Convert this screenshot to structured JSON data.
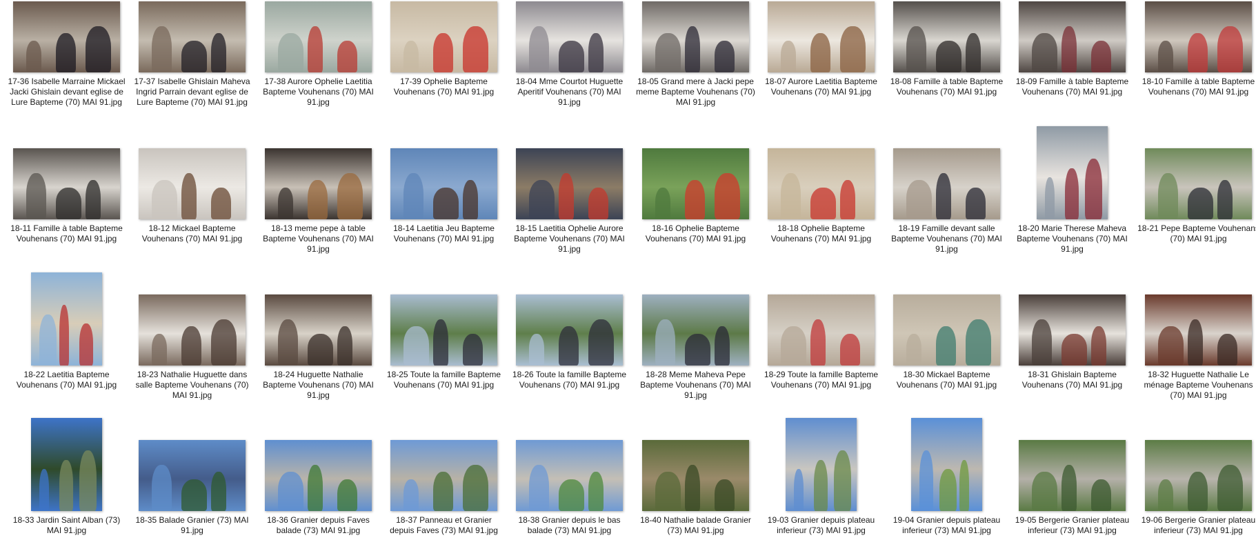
{
  "view": {
    "type": "file-explorer-large-icons",
    "items": [
      {
        "name": "17-36 Isabelle Marraine Mickael Jacki Ghislain devant eglise de Lure Bapteme (70) MAI 91.jpg",
        "orientation": "landscape",
        "palette": [
          "#6b5a4e",
          "#b9b0a4",
          "#1c1a22"
        ]
      },
      {
        "name": "17-37 Isabelle Ghislain Maheva Ingrid Parrain devant eglise de Lure Bapteme (70) MAI 91.jpg",
        "orientation": "landscape",
        "palette": [
          "#7a6a5c",
          "#c4bcb0",
          "#221f26"
        ]
      },
      {
        "name": "17-38 Aurore Ophelie Laetitia Bapteme Vouhenans (70) MAI 91.jpg",
        "orientation": "landscape",
        "palette": [
          "#9aa8a0",
          "#cfd3cc",
          "#b83a32"
        ]
      },
      {
        "name": "17-39 Ophelie Bapteme Vouhenans (70) MAI 91.jpg",
        "orientation": "landscape",
        "palette": [
          "#c7b9a3",
          "#dcd2c1",
          "#c8322a"
        ]
      },
      {
        "name": "18-04 Mme Courtot Huguette Aperitif Vouhenans (70) MAI 91.jpg",
        "orientation": "landscape",
        "palette": [
          "#8d8a90",
          "#e6e3df",
          "#3a3440"
        ]
      },
      {
        "name": "18-05 Grand mere à Jacki pepe meme Bapteme Vouhenans (70) MAI 91.jpg",
        "orientation": "landscape",
        "palette": [
          "#6f6a66",
          "#dcd8d2",
          "#2c2a35"
        ]
      },
      {
        "name": "18-07 Aurore Laetitia Bapteme Vouhenans (70) MAI 91.jpg",
        "orientation": "landscape",
        "palette": [
          "#b9a995",
          "#ece7df",
          "#8a6040"
        ]
      },
      {
        "name": "18-08 Famille à table Bapteme Vouhenans (70) MAI 91.jpg",
        "orientation": "landscape",
        "palette": [
          "#55504c",
          "#d9d6d0",
          "#2f2b2a"
        ]
      },
      {
        "name": "18-09 Famille à table Bapteme Vouhenans (70) MAI 91.jpg",
        "orientation": "landscape",
        "palette": [
          "#4f4743",
          "#cfcac4",
          "#7a2f35"
        ]
      },
      {
        "name": "18-10 Famille à table Bapteme Vouhenans (70) MAI 91.jpg",
        "orientation": "landscape",
        "palette": [
          "#5b4e46",
          "#cfc7bd",
          "#c0393a"
        ]
      },
      {
        "name": "18-11 Famille à table Bapteme Vouhenans (70) MAI 91.jpg",
        "orientation": "landscape",
        "palette": [
          "#5a5550",
          "#d8d4ce",
          "#2e2c2b"
        ]
      },
      {
        "name": "18-12 Mickael Bapteme Vouhenans (70) MAI 91.jpg",
        "orientation": "landscape",
        "palette": [
          "#c9c4be",
          "#ece9e4",
          "#6a4a34"
        ]
      },
      {
        "name": "18-13 meme pepe à table Bapteme Vouhenans (70) MAI 91.jpg",
        "orientation": "landscape",
        "palette": [
          "#3b3430",
          "#c8c0b6",
          "#9a6a3e"
        ]
      },
      {
        "name": "18-14 Laetitia Jeu Bapteme Vouhenans (70) MAI 91.jpg",
        "orientation": "landscape",
        "palette": [
          "#5f86b8",
          "#8ba9cf",
          "#4a3328"
        ]
      },
      {
        "name": "18-15 Laetitia Ophelie Aurore Bapteme Vouhenans (70) MAI 91.jpg",
        "orientation": "landscape",
        "palette": [
          "#3c4355",
          "#8c7c66",
          "#c43a2e"
        ]
      },
      {
        "name": "18-16 Ophelie Bapteme Vouhenans (70) MAI 91.jpg",
        "orientation": "landscape",
        "palette": [
          "#4f7a3e",
          "#7aa25a",
          "#cf3a2c"
        ]
      },
      {
        "name": "18-18 Ophelie Bapteme Vouhenans (70) MAI 91.jpg",
        "orientation": "landscape",
        "palette": [
          "#c5b59a",
          "#d9cfbd",
          "#c8342c"
        ]
      },
      {
        "name": "18-19 Famille devant salle Bapteme Vouhenans (70) MAI 91.jpg",
        "orientation": "landscape",
        "palette": [
          "#a59a8c",
          "#d7d2ca",
          "#2a2a34"
        ]
      },
      {
        "name": "18-20 Marie Therese Maheva Bapteme Vouhenans (70) MAI 91.jpg",
        "orientation": "portrait",
        "palette": [
          "#8f9aa5",
          "#e8e4df",
          "#8a2a36"
        ]
      },
      {
        "name": "18-21 Pepe Bapteme Vouhenans (70) MAI 91.jpg",
        "orientation": "landscape",
        "palette": [
          "#6f8a5a",
          "#c9c4bc",
          "#2b2c34"
        ]
      },
      {
        "name": "18-22 Laetitia Bapteme Vouhenans (70) MAI 91.jpg",
        "orientation": "portrait",
        "palette": [
          "#8db3d8",
          "#d8cdb8",
          "#b83030"
        ]
      },
      {
        "name": "18-23 Nathalie Huguette dans salle Bapteme Vouhenans (70) MAI 91.jpg",
        "orientation": "landscape",
        "palette": [
          "#7a6a5e",
          "#e5e1db",
          "#4a3a32"
        ]
      },
      {
        "name": "18-24 Huguette  Nathalie Bapteme Vouhenans (70) MAI 91.jpg",
        "orientation": "landscape",
        "palette": [
          "#5a4a40",
          "#d8d2c8",
          "#3a2f2a"
        ]
      },
      {
        "name": "18-25 Toute la famille Bapteme Vouhenans (70) MAI 91.jpg",
        "orientation": "landscape",
        "palette": [
          "#a9bcd0",
          "#5e7e4a",
          "#2c2c38"
        ]
      },
      {
        "name": "18-26 Toute la famille Bapteme Vouhenans (70) MAI 91.jpg",
        "orientation": "landscape",
        "palette": [
          "#aabed2",
          "#5f7f4b",
          "#2d2d39"
        ]
      },
      {
        "name": "18-28 Meme Maheva Pepe Bapteme Vouhenans (70) MAI 91.jpg",
        "orientation": "landscape",
        "palette": [
          "#9eb0c0",
          "#5d7a48",
          "#2a2a36"
        ]
      },
      {
        "name": "18-29 Toute la famille Bapteme Vouhenans (70) MAI 91.jpg",
        "orientation": "landscape",
        "palette": [
          "#b5a898",
          "#d6d0c6",
          "#c0383a"
        ]
      },
      {
        "name": "18-30 Mickael Bapteme Vouhenans (70) MAI 91.jpg",
        "orientation": "landscape",
        "palette": [
          "#b8ad9c",
          "#cfc6b6",
          "#3f7c6f"
        ]
      },
      {
        "name": "18-31 Ghislain Bapteme Vouhenans (70) MAI 91.jpg",
        "orientation": "landscape",
        "palette": [
          "#4a3f3a",
          "#e6e2dc",
          "#7a3a30"
        ]
      },
      {
        "name": "18-32 Huguette Nathalie Le ménage Bapteme Vouhenans (70) MAI 91.jpg",
        "orientation": "landscape",
        "palette": [
          "#6a3a2c",
          "#d9d3cc",
          "#3a2a24"
        ]
      },
      {
        "name": "18-33 Jardin Saint Alban (73) MAI 91.jpg",
        "orientation": "portrait",
        "palette": [
          "#3e74c8",
          "#2f4a2a",
          "#7a8a5e"
        ]
      },
      {
        "name": "18-35 Balade Granier (73) MAI 91.jpg",
        "orientation": "landscape",
        "palette": [
          "#5e8cc8",
          "#445c8a",
          "#2f5a2e"
        ]
      },
      {
        "name": "18-36 Granier depuis Faves balade (73) MAI 91.jpg",
        "orientation": "landscape",
        "palette": [
          "#5f8fd0",
          "#b9b4aa",
          "#3f7a34"
        ]
      },
      {
        "name": "18-37 Panneau et Granier depuis Faves (73) MAI 91.jpg",
        "orientation": "landscape",
        "palette": [
          "#6e9ad6",
          "#b8b2a6",
          "#4a6e36"
        ]
      },
      {
        "name": "18-38 Granier depuis le bas balade (73) MAI 91.jpg",
        "orientation": "landscape",
        "palette": [
          "#6f9ad4",
          "#c4bfb5",
          "#4e8a3c"
        ]
      },
      {
        "name": "18-40 Nathalie balade Granier (73) MAI 91.jpg",
        "orientation": "landscape",
        "palette": [
          "#5a6a3a",
          "#9a8a6a",
          "#3a4a26"
        ]
      },
      {
        "name": "19-03 Granier depuis plateau inferieur (73) MAI 91.jpg",
        "orientation": "portrait",
        "palette": [
          "#5f8ed0",
          "#c9c6c0",
          "#6a8a4a"
        ]
      },
      {
        "name": "19-04 Granier depuis plateau inferieur (73) MAI 91.jpg",
        "orientation": "portrait",
        "palette": [
          "#5a90d8",
          "#bdb8b0",
          "#6f9a3e"
        ]
      },
      {
        "name": "19-05 Bergerie Granier plateau inferieur (73) MAI 91.jpg",
        "orientation": "landscape",
        "palette": [
          "#5a7a44",
          "#b4b0a8",
          "#3c5a30"
        ]
      },
      {
        "name": "19-06 Bergerie Granier plateau inferieur (73) MAI 91.jpg",
        "orientation": "landscape",
        "palette": [
          "#5c7c46",
          "#b8b4ac",
          "#3d5b31"
        ]
      }
    ]
  }
}
